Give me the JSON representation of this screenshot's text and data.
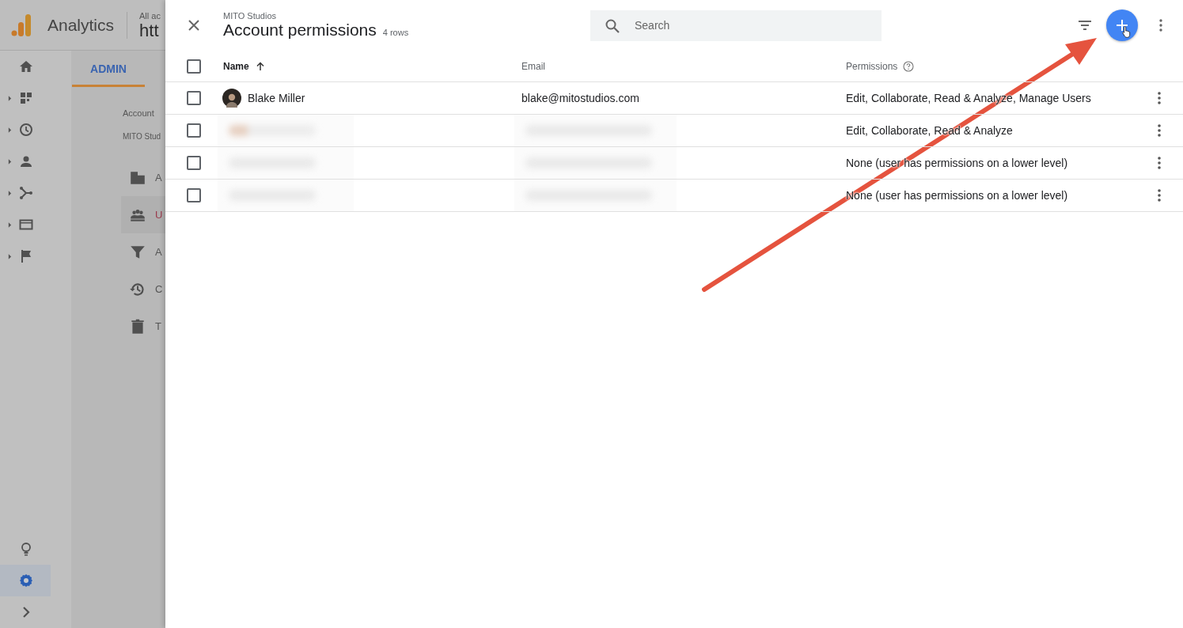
{
  "app": {
    "title": "Analytics",
    "scope": "All ac",
    "property": "htt",
    "rail": [
      {
        "kind": "home",
        "expandable": false
      },
      {
        "kind": "dashboard",
        "expandable": true
      },
      {
        "kind": "clock",
        "expandable": true
      },
      {
        "kind": "person",
        "expandable": true
      },
      {
        "kind": "branch",
        "expandable": true
      },
      {
        "kind": "window",
        "expandable": true
      },
      {
        "kind": "flag",
        "expandable": true
      }
    ],
    "rail_bottom": [
      {
        "kind": "bulb",
        "selected": false
      },
      {
        "kind": "gear",
        "selected": true
      },
      {
        "kind": "chevron",
        "selected": false
      }
    ],
    "tabs": [
      {
        "label": "ADMIN",
        "selected": true
      }
    ],
    "account_label": "Account",
    "account_name": "MITO Stud",
    "menu": [
      {
        "kind": "building",
        "label": "A",
        "selected": false
      },
      {
        "kind": "people",
        "label": "U",
        "selected": true
      },
      {
        "kind": "filter",
        "label": "A",
        "selected": false
      },
      {
        "kind": "history",
        "label": "C",
        "selected": false
      },
      {
        "kind": "trash",
        "label": "T",
        "selected": false
      }
    ]
  },
  "panel": {
    "all_checked": false,
    "subtitle": "MITO Studios",
    "title": "Account permissions",
    "count": "4 rows",
    "search": {
      "placeholder": "Search"
    },
    "columns": [
      {
        "label": "Name",
        "sorted": true
      },
      {
        "label": "Email",
        "sorted": false
      },
      {
        "label": "Permissions",
        "sorted": false
      }
    ],
    "rows": [
      {
        "name": "Blake Miller",
        "email": "blake@mitostudios.com",
        "permissions": "Edit, Collaborate, Read & Analyze, Manage Users",
        "blurred": false,
        "checked": false
      },
      {
        "permissions": "Edit, Collaborate, Read & Analyze",
        "blurred": true,
        "checked": false
      },
      {
        "permissions": "None (user has permissions on a lower level)",
        "blurred": true,
        "checked": false
      },
      {
        "permissions": "None (user has permissions on a lower level)",
        "blurred": true,
        "checked": false
      }
    ]
  },
  "annotation": {
    "kind": "arrow"
  }
}
